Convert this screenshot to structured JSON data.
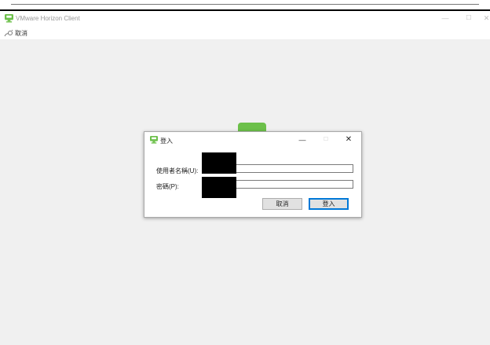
{
  "window": {
    "title": "VMware Horizon Client",
    "minimize_glyph": "—",
    "maximize_glyph": "☐",
    "close_glyph": "✕"
  },
  "menubar": {
    "cancel_label": "取消"
  },
  "login_dialog": {
    "title": "登入",
    "minimize_glyph": "—",
    "maximize_glyph": "☐",
    "close_glyph": "✕",
    "username_label": "使用者名稱(U):",
    "username_value": "",
    "password_label": "密碼(P):",
    "password_value": "",
    "cancel_button": "取消",
    "login_button": "登入"
  },
  "colors": {
    "accent": "#0078d7",
    "brand_green": "#6cc04a",
    "background": "#f0f0f0"
  },
  "icons": {
    "app": "vmware-horizon-logo-icon",
    "menu_cancel": "disconnect-icon"
  }
}
